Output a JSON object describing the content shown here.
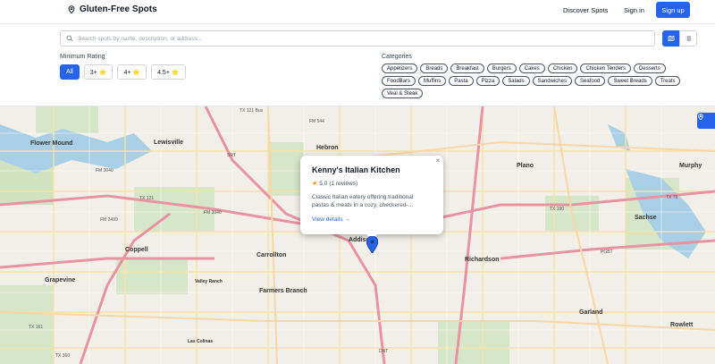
{
  "header": {
    "app_title": "Gluten-Free Spots",
    "nav": {
      "discover": "Discover Spots",
      "signin": "Sign in",
      "signup": "Sign up"
    }
  },
  "search": {
    "placeholder": "Search spots by name, description, or address..."
  },
  "rating": {
    "label": "Minimum Rating",
    "options": [
      "All",
      "3+ ⭐",
      "4+ ⭐",
      "4.5+ ⭐"
    ],
    "selected": "All"
  },
  "categories": {
    "label": "Categories",
    "items": [
      "Appetizers",
      "Breads",
      "Breakfast",
      "Burgers",
      "Cakes",
      "Chicken",
      "Chicken Tenders",
      "Desserts",
      "FoodBars",
      "Muffins",
      "Pasta",
      "Pizza",
      "Salads",
      "Sandwiches",
      "Seafood",
      "Sweet Breads",
      "Treats",
      "Veal & Steak"
    ]
  },
  "popup": {
    "title": "Kenny's Italian Kitchen",
    "rating": "5.0",
    "reviews": "(1 reviews)",
    "description": "Classic Italian eatery offering traditional pastas & meats in a cozy, checkered-...",
    "link": "View details →",
    "close": "×"
  },
  "map": {
    "places": [
      "Lewisville",
      "Flower Mound",
      "Hebron",
      "Plano",
      "Murphy",
      "Sachse",
      "Coppell",
      "Carrollton",
      "Addison",
      "Richardson",
      "Grapevine",
      "Farmers Branch",
      "Valley Ranch",
      "Garland",
      "Rowlett",
      "Las Colinas"
    ],
    "road_labels": [
      "TX 121 Bus",
      "FM 544",
      "TX 121",
      "SRT",
      "FM 3040",
      "FM 2499",
      "TX 190",
      "TX 78",
      "PGBT",
      "DNT",
      "TX 161",
      "TX 360",
      "FM 3040"
    ]
  },
  "colors": {
    "accent": "#2563eb",
    "map_bg": "#f2efe9"
  }
}
